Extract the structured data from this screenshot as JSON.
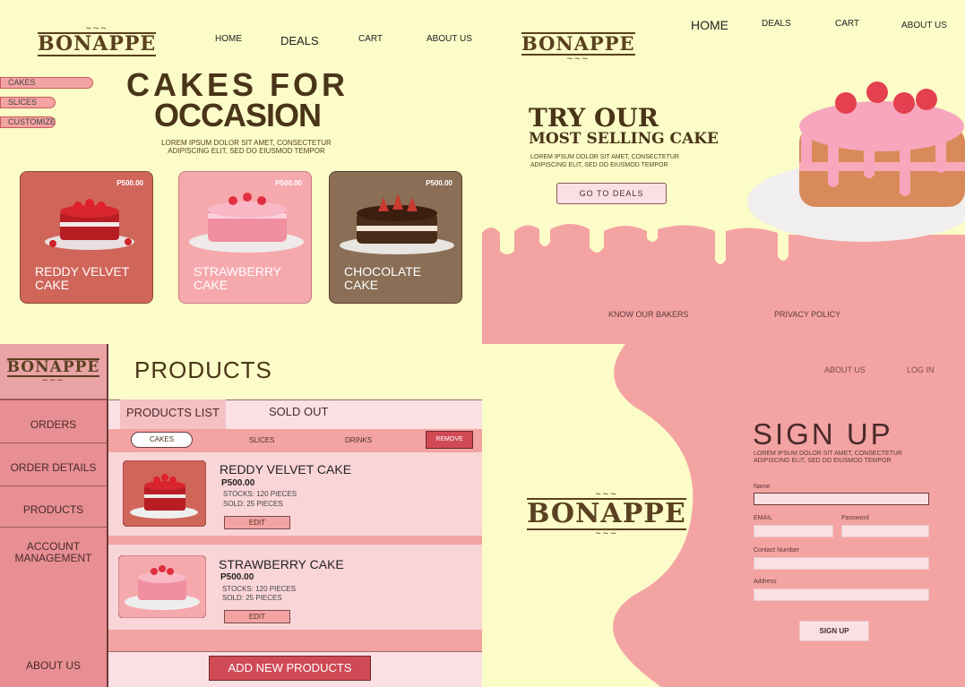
{
  "brand": "BONAPPE",
  "q1": {
    "nav": {
      "home": "HOME",
      "deals": "DEALS",
      "cart": "CART",
      "about": "ABOUT US"
    },
    "filters": [
      "CAKES",
      "SLICES",
      "CUSTOMIZE"
    ],
    "headline1": "CAKES FOR",
    "headline2": "OCCASION",
    "lorem": "LOREM IPSUM DOLOR SIT AMET, CONSECTETUR ADIPISCING ELIT, SED DO EIUSMOD TEMPOR",
    "cards": [
      {
        "name1": "REDDY VELVET",
        "name2": "CAKE",
        "price": "P500.00",
        "color": "#d0655a"
      },
      {
        "name1": "STRAWBERRY",
        "name2": "CAKE",
        "price": "P500.00",
        "color": "#f6a9ad"
      },
      {
        "name1": "CHOCOLATE",
        "name2": "CAKE",
        "price": "P500.00",
        "color": "#8a6e55"
      }
    ]
  },
  "q2": {
    "nav": {
      "home": "HOME",
      "deals": "DEALS",
      "cart": "CART",
      "about": "ABOUT US"
    },
    "title1": "TRY OUR",
    "title2": "MOST SELLING CAKE",
    "lorem": "LOREM IPSUM DOLOR SIT AMET, CONSECTETUR ADIPISCING ELIT, SED DO EIUSMOD TEMPOR",
    "cta": "GO TO DEALS",
    "footer": {
      "bakers": "KNOW OUR BAKERS",
      "privacy": "PRIVACY POLICY"
    }
  },
  "q3": {
    "title": "PRODUCTS",
    "side": [
      "ORDERS",
      "ORDER DETAILS",
      "PRODUCTS",
      "ACCOUNT MANAGEMENT",
      "ABOUT US"
    ],
    "tabs": {
      "list": "PRODUCTS LIST",
      "sold": "SOLD OUT"
    },
    "cats": {
      "cakes": "CAKES",
      "slices": "SLICES",
      "drinks": "DRINKS",
      "remove": "REMOVE"
    },
    "products": [
      {
        "name": "REDDY VELVET CAKE",
        "price": "P500.00",
        "stocks": "STOCKS: 120 PIECES",
        "sold": "SOLD: 25 PIECES",
        "edit": "EDIT"
      },
      {
        "name": "STRAWBERRY CAKE",
        "price": "P500.00",
        "stocks": "STOCKS: 120 PIECES",
        "sold": "SOLD: 25 PIECES",
        "edit": "EDIT"
      }
    ],
    "add": "ADD NEW PRODUCTS"
  },
  "q4": {
    "nav": {
      "about": "ABOUT US",
      "login": "LOG IN"
    },
    "title": "SIGN UP",
    "lorem": "LOREM IPSUM DOLOR SIT AMET, CONSECTETUR ADIPISCING ELIT, SED DO EIUSMOD TEMPOR",
    "labels": {
      "name": "Name",
      "email": "EMAIL",
      "password": "Password",
      "contact": "Contact Number",
      "address": "Address"
    },
    "submit": "SIGN UP"
  }
}
